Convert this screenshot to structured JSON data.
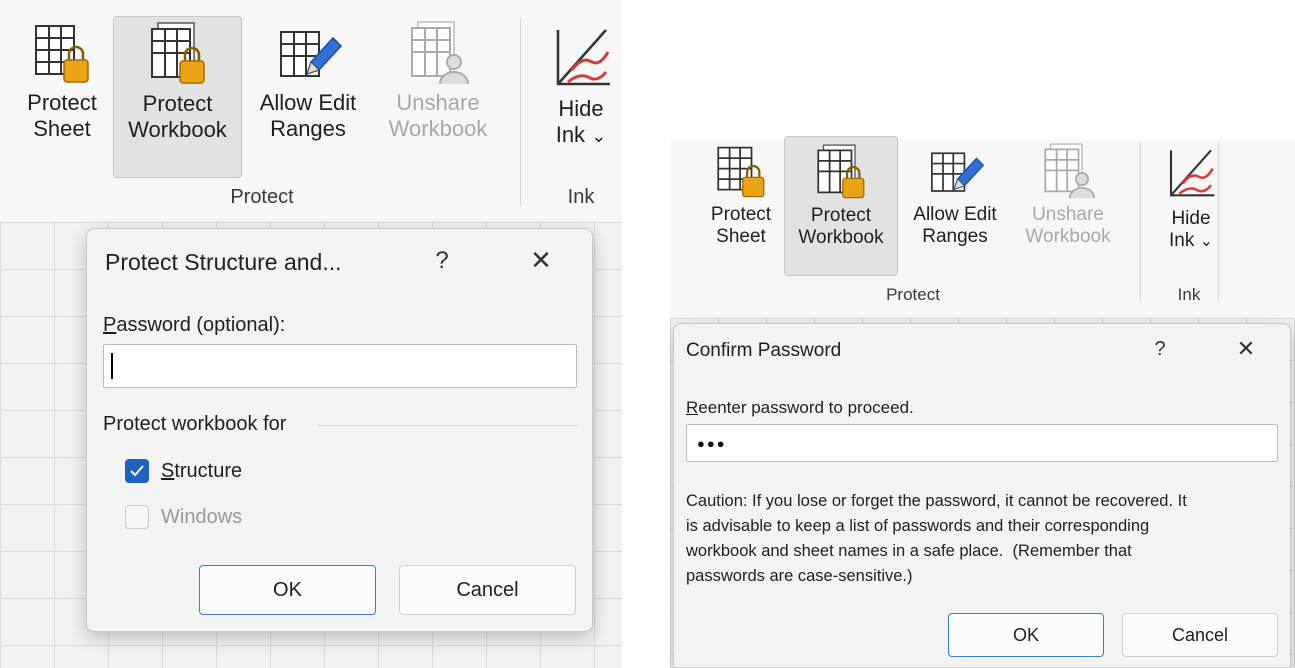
{
  "left": {
    "ribbon": {
      "buttons": [
        {
          "line1": "Protect",
          "line2": "Sheet"
        },
        {
          "line1": "Protect",
          "line2": "Workbook"
        },
        {
          "line1": "Allow Edit",
          "line2": "Ranges"
        },
        {
          "line1": "Unshare",
          "line2": "Workbook"
        },
        {
          "line1": "Hide",
          "line2": "Ink",
          "chevron": "⌄"
        }
      ],
      "group_protect": "Protect",
      "group_ink": "Ink"
    },
    "dialog": {
      "title": "Protect Structure and...",
      "help": "?",
      "close": "✕",
      "password_label_u": "P",
      "password_label_rest": "assword (optional):",
      "password_value": "",
      "section": "Protect workbook for",
      "structure_u": "S",
      "structure_rest": "tructure",
      "structure_checked": true,
      "windows_label": "Windows",
      "windows_checked": false,
      "ok": "OK",
      "cancel": "Cancel"
    }
  },
  "right": {
    "ribbon": {
      "buttons": [
        {
          "line1": "Protect",
          "line2": "Sheet"
        },
        {
          "line1": "Protect",
          "line2": "Workbook"
        },
        {
          "line1": "Allow Edit",
          "line2": "Ranges"
        },
        {
          "line1": "Unshare",
          "line2": "Workbook"
        },
        {
          "line1": "Hide",
          "line2": "Ink",
          "chevron": "⌄"
        }
      ],
      "group_protect": "Protect",
      "group_ink": "Ink"
    },
    "dialog": {
      "title": "Confirm Password",
      "help": "?",
      "close": "✕",
      "reenter_u": "R",
      "reenter_rest": "eenter password to proceed.",
      "password_mask": "●●●",
      "caution_line1": "Caution: If you lose or forget the password, it cannot be recovered. It",
      "caution_line2": "is advisable to keep a list of passwords and their corresponding",
      "caution_line3": "workbook and sheet names in a safe place.  (Remember that",
      "caution_line4": "passwords are case-sensitive.)",
      "ok": "OK",
      "cancel": "Cancel"
    }
  },
  "colors": {
    "accent": "#1e62c0",
    "lock": "#e8a317",
    "pen_blue": "#2f6fd6",
    "ink_red": "#d93a3a"
  },
  "icons": [
    "sheet-lock-icon",
    "workbook-lock-icon",
    "allow-edit-ranges-icon",
    "unshare-workbook-icon",
    "hide-ink-icon",
    "help-icon",
    "close-icon",
    "checkmark-icon"
  ]
}
